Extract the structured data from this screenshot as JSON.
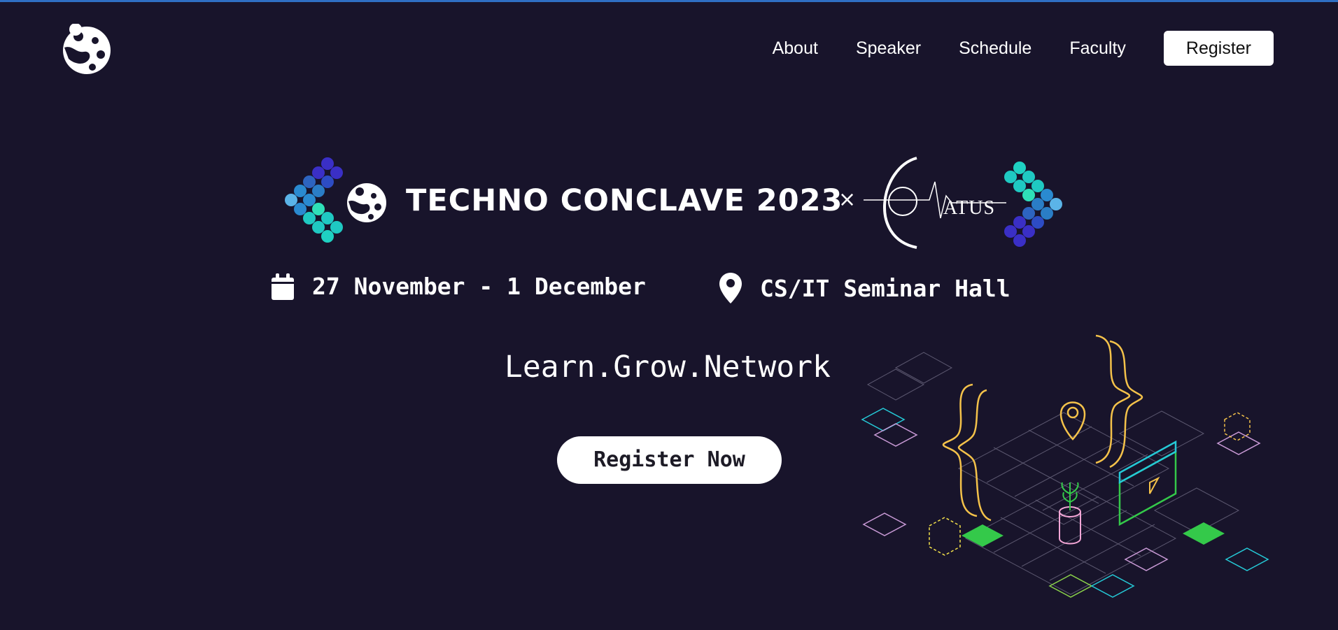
{
  "nav": {
    "items": [
      {
        "label": "About"
      },
      {
        "label": "Speaker"
      },
      {
        "label": "Schedule"
      },
      {
        "label": "Faculty"
      }
    ],
    "register_label": "Register"
  },
  "hero": {
    "title": "TECHNO CONCLAVE 2023",
    "cross": "×",
    "partner": "ATUS",
    "date": "27 November - 1 December",
    "venue": "CS/IT Seminar Hall",
    "tagline": "Learn.Grow.Network",
    "cta_label": "Register Now"
  },
  "icons": {
    "logo": "globe-splash-icon",
    "date": "calendar-icon",
    "venue": "map-pin-icon"
  },
  "colors": {
    "background": "#18142b",
    "accent_line": "#2f6fc4",
    "dot_blue": "#3a2fc6",
    "dot_teal": "#1fd1c2",
    "illustration_gold": "#f4c24a",
    "illustration_green": "#34c94a",
    "illustration_cyan": "#25c9d6"
  }
}
